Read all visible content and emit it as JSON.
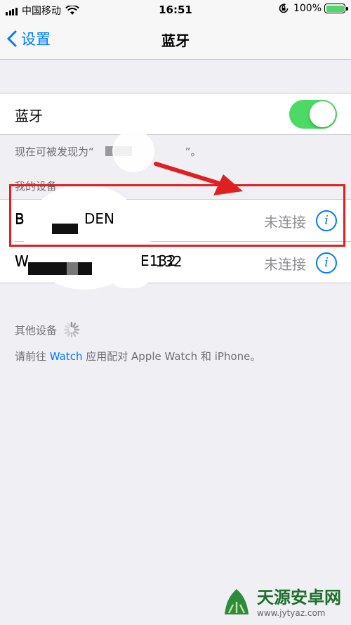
{
  "status_bar": {
    "carrier": "中国移动",
    "time": "16:51",
    "battery_percent": "100%",
    "battery_level": 1.0,
    "icons": [
      "signal-bars-icon",
      "wifi-icon",
      "rotation-lock-icon",
      "battery-icon"
    ]
  },
  "nav": {
    "back_label": "设置",
    "title": "蓝牙"
  },
  "bluetooth": {
    "label": "蓝牙",
    "enabled": true,
    "switch_color": "#4cd964",
    "discoverable_prefix": "现在可被发现为“",
    "discoverable_suffix": "”。"
  },
  "my_devices": {
    "header": "我的设备",
    "items": [
      {
        "name_start": "B",
        "name_end": "DEN",
        "status": "未连接",
        "info_glyph": "i"
      },
      {
        "name_start": "W",
        "name_end": "E132",
        "status": "未连接",
        "info_glyph": "i"
      }
    ]
  },
  "other_devices": {
    "header": "其他设备",
    "hint_before": "请前往 ",
    "hint_link": "Watch",
    "hint_after": " 应用配对 Apple Watch 和 iPhone。"
  },
  "colors": {
    "accent": "#007aff",
    "annotation": "#e02020",
    "background": "#efeff4"
  },
  "watermark": {
    "brand": "天源安卓网",
    "url": "www.jytyaz.com"
  }
}
